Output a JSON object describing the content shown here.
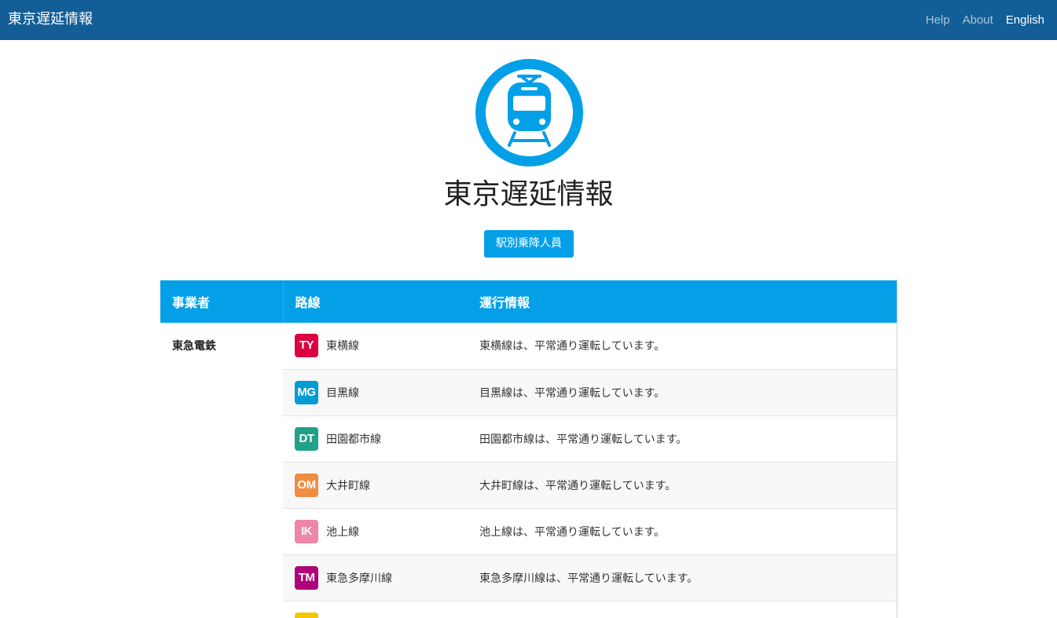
{
  "navbar": {
    "brand": "東京遅延情報",
    "links": [
      {
        "label": "Help"
      },
      {
        "label": "About"
      },
      {
        "label": "English"
      }
    ]
  },
  "hero": {
    "logo_icon": "train-icon",
    "title": "東京遅延情報",
    "ridership_button": "駅別乗降人員"
  },
  "table": {
    "headers": {
      "operator": "事業者",
      "line": "路線",
      "status": "運行情報"
    },
    "operator": "東急電鉄",
    "rows": [
      {
        "code": "TY",
        "color": "#dc0040",
        "line": "東横線",
        "status": "東横線は、平常通り運転しています。"
      },
      {
        "code": "MG",
        "color": "#009cd2",
        "line": "目黒線",
        "status": "目黒線は、平常通り運転しています。"
      },
      {
        "code": "DT",
        "color": "#20a288",
        "line": "田園都市線",
        "status": "田園都市線は、平常通り運転しています。"
      },
      {
        "code": "OM",
        "color": "#f18c43",
        "line": "大井町線",
        "status": "大井町線は、平常通り運転しています。"
      },
      {
        "code": "IK",
        "color": "#ee86a7",
        "line": "池上線",
        "status": "池上線は、平常通り運転しています。"
      },
      {
        "code": "TM",
        "color": "#ae0378",
        "line": "東急多摩川線",
        "status": "東急多摩川線は、平常通り運転しています。"
      },
      {
        "code": "",
        "color": "#f5c600",
        "line": "",
        "status": ""
      }
    ]
  },
  "colors": {
    "navbar": "#135e96",
    "accent": "#03a0e8"
  }
}
